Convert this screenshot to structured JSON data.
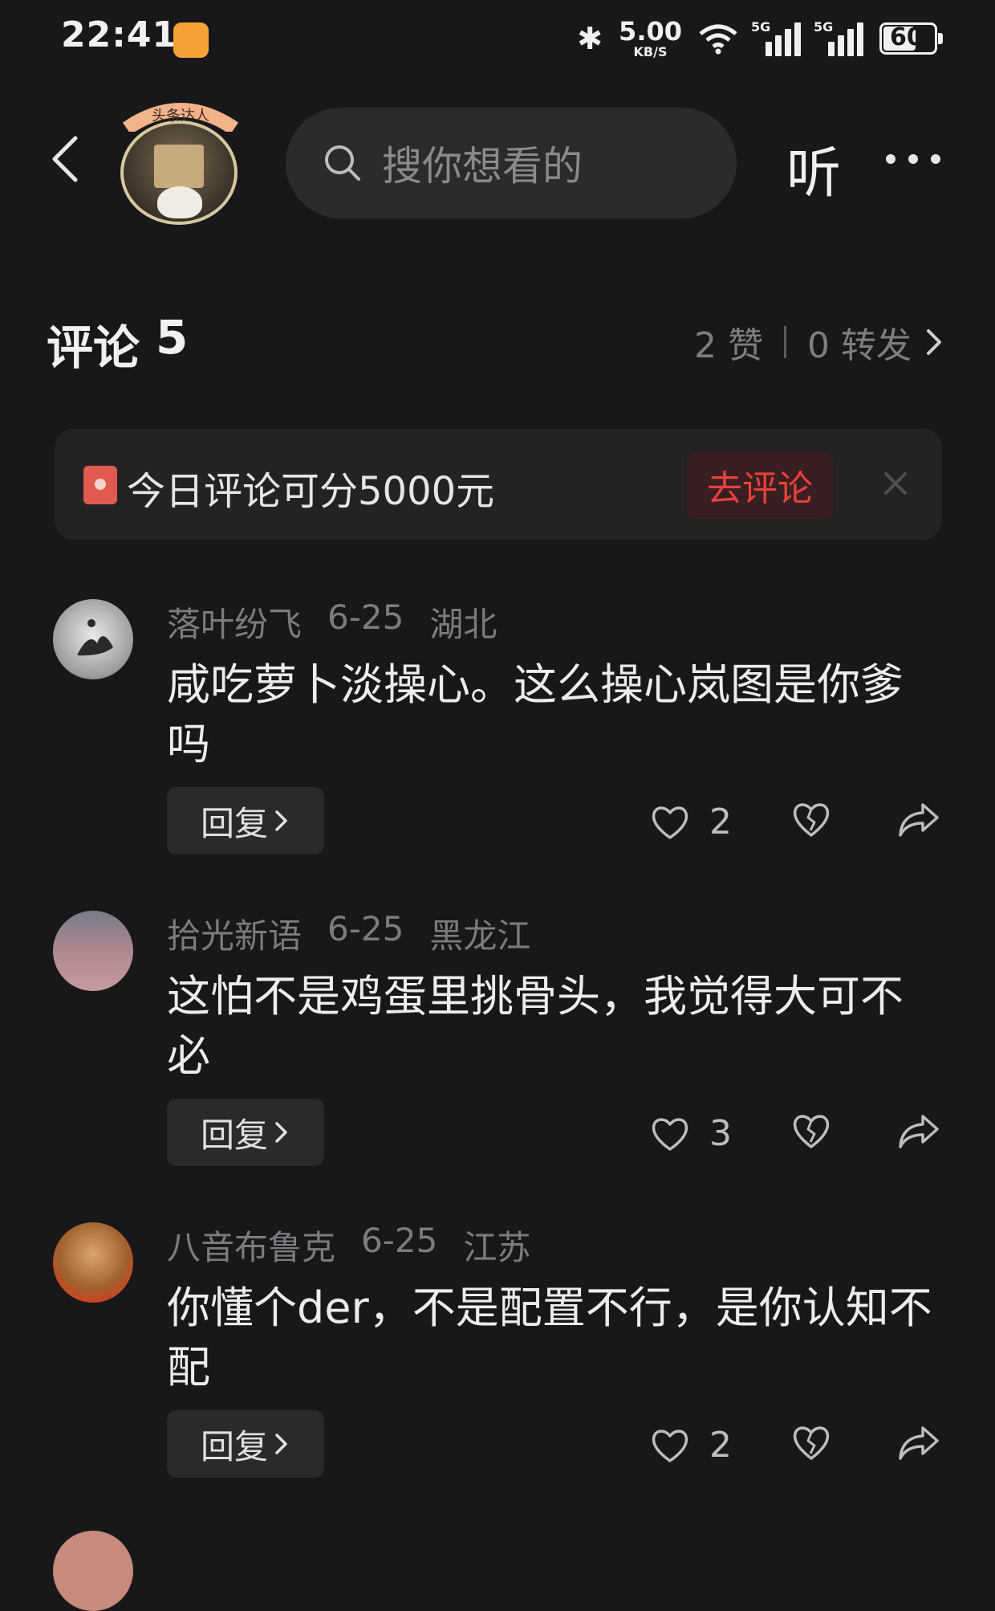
{
  "status_bar": {
    "time": "22:41",
    "net_speed": "5.00",
    "net_unit": "KB/S",
    "signal_tag_1": "5G",
    "signal_tag_2": "5G",
    "battery": "60"
  },
  "header": {
    "badge_text": "头条达人",
    "search_placeholder": "搜你想看的",
    "listen_label": "听"
  },
  "comments_header": {
    "title": "评论",
    "count": "5",
    "likes": "2 赞",
    "shares": "0 转发"
  },
  "banner": {
    "text": "今日评论可分5000元",
    "button": "去评论"
  },
  "comments": [
    {
      "user": "落叶纷飞",
      "date": "6-25",
      "region": "湖北",
      "text": "咸吃萝卜淡操心。这么操心岚图是你爹吗",
      "reply_label": "回复",
      "likes": "2"
    },
    {
      "user": "拾光新语",
      "date": "6-25",
      "region": "黑龙江",
      "text": "这怕不是鸡蛋里挑骨头，我觉得大可不必",
      "reply_label": "回复",
      "likes": "3"
    },
    {
      "user": "八音布鲁克",
      "date": "6-25",
      "region": "江苏",
      "text": "你懂个der，不是配置不行，是你认知不配",
      "reply_label": "回复",
      "likes": "2"
    }
  ],
  "colors": {
    "background": "#18181a",
    "accent_red": "#e8413c",
    "muted_text": "#7c7c80"
  },
  "icons": {
    "back": "back-arrow-icon",
    "search": "search-icon",
    "more": "more-dots-icon",
    "like": "heart-icon",
    "dislike": "broken-heart-icon",
    "share": "share-icon",
    "close": "close-icon",
    "red_envelope": "red-envelope-icon"
  }
}
